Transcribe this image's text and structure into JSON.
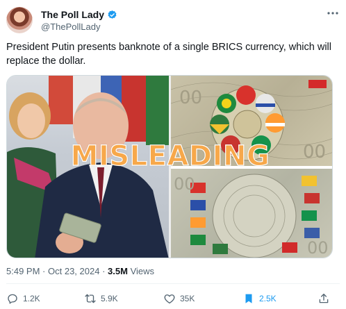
{
  "author": {
    "display_name": "The Poll Lady",
    "handle": "@ThePollLady",
    "verified": true
  },
  "tweet": {
    "text": "President Putin presents banknote of a single BRICS currency, which will replace the dollar.",
    "overlay_label": "MISLEADING",
    "time": "5:49 PM",
    "date": "Oct 23, 2024",
    "views_count": "3.5M",
    "views_label": "Views"
  },
  "actions": {
    "replies": "1.2K",
    "reposts": "5.9K",
    "likes": "35K",
    "bookmarks": "2.5K"
  },
  "colors": {
    "accent": "#1d9bf0",
    "overlay": "#f7a84a",
    "muted": "#536471"
  }
}
